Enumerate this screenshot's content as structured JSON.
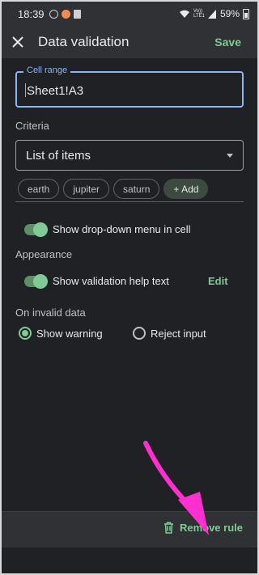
{
  "status_bar": {
    "time": "18:39",
    "network": "Vo)) LTE1",
    "battery": "59%"
  },
  "app_bar": {
    "close_icon": "close-icon",
    "title": "Data validation",
    "save_label": "Save"
  },
  "cell_range": {
    "label": "Cell range",
    "value": "Sheet1!A3"
  },
  "criteria": {
    "label": "Criteria",
    "selected": "List of items",
    "items": [
      "earth",
      "jupiter",
      "saturn"
    ],
    "add_label": "+ Add"
  },
  "dropdown_toggle": {
    "label": "Show drop-down menu in cell",
    "on": true
  },
  "appearance": {
    "label": "Appearance",
    "help_text_label": "Show validation help text",
    "help_text_on": true,
    "edit_label": "Edit"
  },
  "invalid_data": {
    "label": "On invalid data",
    "options": [
      "Show warning",
      "Reject input"
    ],
    "selected": "Show warning"
  },
  "bottom": {
    "remove_label": "Remove rule",
    "remove_icon": "trash-icon"
  },
  "colors": {
    "accent": "#81c995",
    "focus": "#8ab4f8",
    "background": "#202124",
    "annotation_arrow": "#ff2fd0"
  }
}
